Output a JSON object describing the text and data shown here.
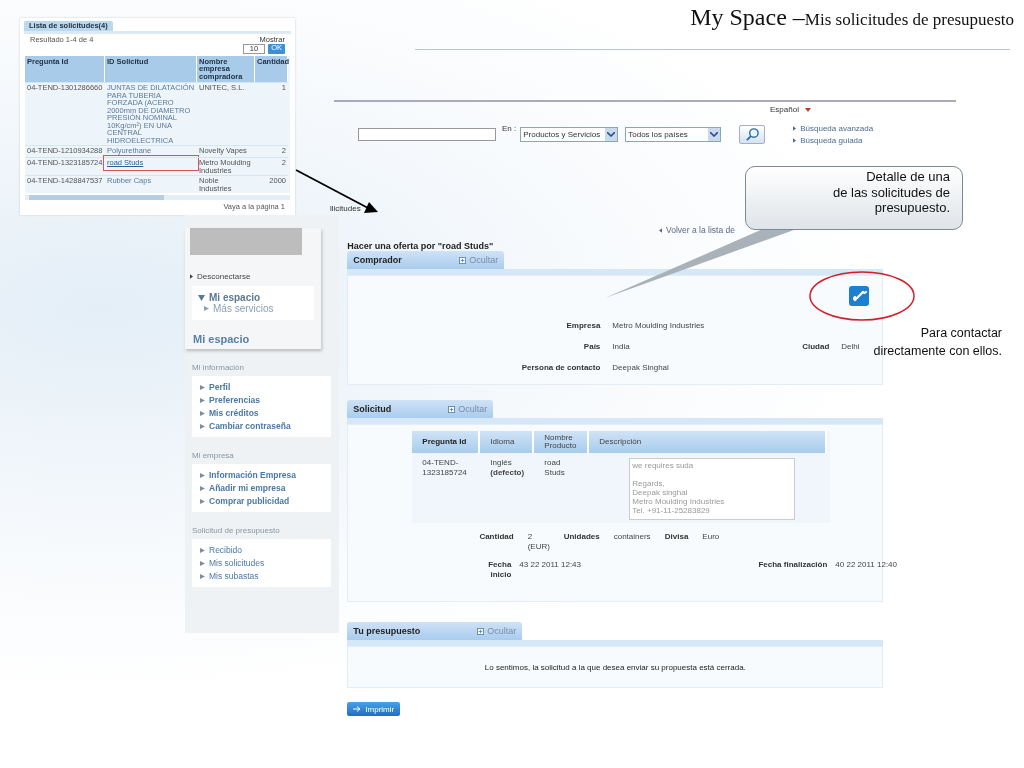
{
  "slide": {
    "title": "My Space",
    "separator": "–",
    "subtitle": "Mis solicitudes de presupuesto"
  },
  "inset": {
    "tab": "Lista de solicitudes(4)",
    "result": "Resultado 1-4 de 4",
    "show_label": "Mostrar",
    "show_value": "10",
    "ok": "OK",
    "columns": [
      "Pregunta Id",
      "ID Solicitud",
      "Nombre empresa compradora",
      "Cantidad"
    ],
    "rows": [
      {
        "id": "04-TEND-1301286660",
        "request": "JUNTAS DE DILATACIÓN PARA TUBERIA FORZADA (ACERO 2000mm DE DIAMETRO PRESIÓN NOMINAL 10Kg/cm²) EN UNA CENTRAL HIDROELECTRICA",
        "company": "UNITEC, S.L.",
        "qty": "1",
        "highlighted": false
      },
      {
        "id": "04-TEND-1210934288",
        "request": "Polyurethane",
        "company": "Novelty Vapes",
        "qty": "2",
        "highlighted": false
      },
      {
        "id": "04-TEND-1323185724",
        "request": "road Studs",
        "company": "Metro Moulding Industries",
        "qty": "2",
        "highlighted": true
      },
      {
        "id": "04-TEND-1428847537",
        "request": "Rubber Caps",
        "company": "Noble Industries",
        "qty": "2000",
        "highlighted": false
      }
    ],
    "pager": "Vaya a la página 1"
  },
  "header": {
    "language": "Español",
    "search_label": "En :",
    "category": "Productos y Servicios",
    "country": "Todos los países",
    "links": [
      "Búsqueda avanzada",
      "Búsqueda guiada"
    ],
    "breadcrumb": "llicitudes"
  },
  "sidebar": {
    "logout": "Desconectarse",
    "menu_title": "Mi espacio",
    "menu_item": "Más servicios",
    "heading": "Mi espacio",
    "groups": [
      {
        "title": "Mi información",
        "items": [
          "Perfil",
          "Preferencias",
          "Mis créditos",
          "Cambiar contraseña"
        ]
      },
      {
        "title": "Mi empresa",
        "items": [
          "Información Empresa",
          "Añadir mi empresa",
          "Comprar publicidad"
        ]
      },
      {
        "title": "Solicitud de presupuesto",
        "items": [
          "Recibido",
          "Mis solicitudes",
          "Mis subastas"
        ]
      }
    ]
  },
  "content": {
    "back_link": "Volver a la lista de",
    "offer_title": "Hacer una oferta por \"road Studs\"",
    "buyer": {
      "title": "Comprador",
      "hide_label": "Ocultar",
      "company_label": "Empresa",
      "company": "Metro Moulding Industries",
      "country_label": "País",
      "country": "India",
      "city_label": "Ciudad",
      "city": "Delhi",
      "contact_label": "Persona de contacto",
      "contact": "Deepak Singhal"
    },
    "request": {
      "title": "Solicitud",
      "hide_label": "Ocultar",
      "columns": [
        "Pregunta Id",
        "Idioma",
        "Nombre Producto",
        "Descripción"
      ],
      "row": {
        "id": "04-TEND-1323185724",
        "language": "Inglés **(defecto)**",
        "product": "road Studs",
        "description": "we requires suda\n\nRegards,\nDeepak singhal\nMetro Moulding Industries\nTel. +91-11-25283829"
      },
      "quantity_label": "Cantidad",
      "quantity": "2 (EUR)",
      "units_label": "Unidades",
      "units": "containers",
      "currency_label": "Divisa",
      "currency": "Euro",
      "start_label": "Fecha inicio",
      "start": "43 22 2011 12:43",
      "end_label": "Fecha finalización",
      "end": "40 22 2011 12:40"
    },
    "quote": {
      "title": "Tu presupuesto",
      "hide_label": "Ocultar",
      "message": "Lo sentimos, la solicitud a la que desea enviar su propuesta está cerrada."
    },
    "print": "Imprimir"
  },
  "callouts": [
    {
      "text": "Detalle de una\nde las solicitudes de\npresupuesto."
    },
    {
      "text": "Para contactar\ndirectamente con ellos."
    }
  ]
}
